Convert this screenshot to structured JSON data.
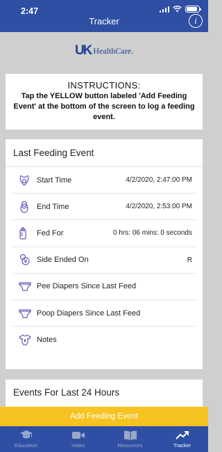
{
  "status": {
    "time": "2:47",
    "battery_level": 0.9
  },
  "nav": {
    "title": "Tracker",
    "info_icon": "info-icon"
  },
  "logo": {
    "mark": "UK",
    "text": "HealthCare."
  },
  "instructions": {
    "title": "INSTRUCTIONS:",
    "body": "Tap the YELLOW button labeled 'Add Feeding Event' at the bottom of the screen to log a feeding event."
  },
  "last_feeding": {
    "header": "Last Feeding Event",
    "rows": [
      {
        "icon": "baby-bib-icon",
        "label": "Start Time",
        "value": "4/2/2020, 2:47:00 PM"
      },
      {
        "icon": "swaddled-baby-icon",
        "label": "End Time",
        "value": "4/2/2020, 2:53:00 PM"
      },
      {
        "icon": "bottle-icon",
        "label": "Fed For",
        "value": "0 hrs: 06 mins: 0 seconds"
      },
      {
        "icon": "nursing-icon",
        "label": "Side Ended On",
        "value": "R"
      },
      {
        "icon": "diaper-icon",
        "label": "Pee Diapers Since Last Feed",
        "value": ""
      },
      {
        "icon": "diaper-icon",
        "label": "Poop Diapers Since Last Feed",
        "value": ""
      },
      {
        "icon": "onesie-icon",
        "label": "Notes",
        "value": ""
      }
    ]
  },
  "events24": {
    "header": "Events For Last 24 Hours"
  },
  "add_button": {
    "label": "Add Feeding Event"
  },
  "tabs": [
    {
      "label": "Education",
      "icon": "graduation-cap-icon",
      "active": false
    },
    {
      "label": "Video",
      "icon": "video-camera-icon",
      "active": false
    },
    {
      "label": "Resources",
      "icon": "book-icon",
      "active": false
    },
    {
      "label": "Tracker",
      "icon": "trend-arrow-icon",
      "active": true
    }
  ],
  "colors": {
    "primary": "#2e4fa3",
    "accent": "#f7c321",
    "background": "#cfcfcf",
    "icon": "#6b5bb8"
  }
}
